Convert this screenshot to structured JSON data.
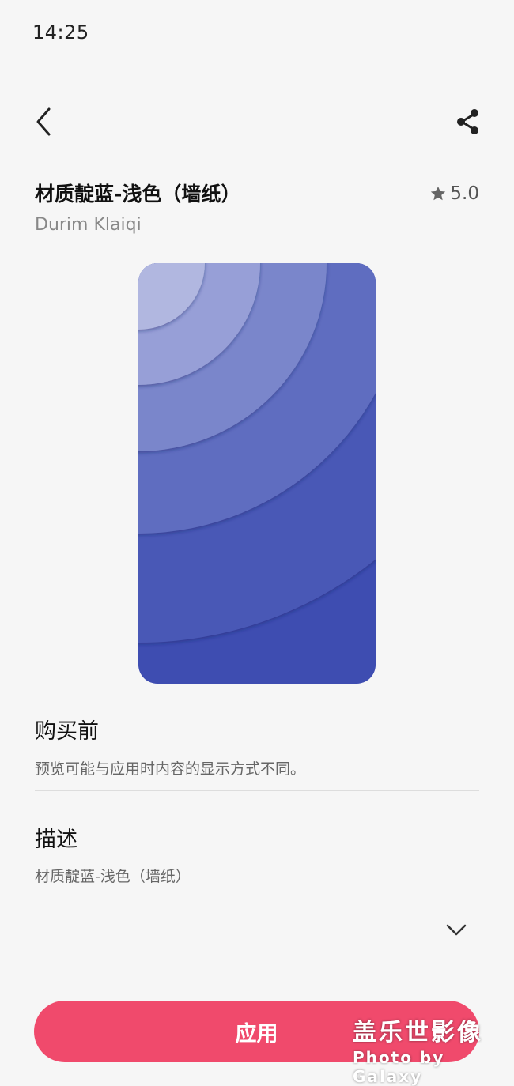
{
  "status_bar": {
    "time": "14:25"
  },
  "header": {
    "back_icon": "chevron-left-icon",
    "share_icon": "share-icon"
  },
  "item": {
    "title": "材质靛蓝-浅色（墙纸）",
    "author": "Durim Klaiqi",
    "rating": "5.0",
    "rating_icon": "star-icon"
  },
  "preview": {
    "colors": [
      "#b1b7e0",
      "#979fd7",
      "#7a86cb",
      "#5f6dc0",
      "#4a58b6",
      "#3e4db1"
    ]
  },
  "before_purchase": {
    "title": "购买前",
    "text": "预览可能与应用时内容的显示方式不同。"
  },
  "description": {
    "title": "描述",
    "text": "材质靛蓝-浅色（墙纸）",
    "expand_icon": "chevron-down-icon"
  },
  "apply_button": {
    "label": "应用",
    "color": "#f04a6c"
  },
  "watermark": {
    "main": "盖乐世影像",
    "sub": "Photo by Galaxy"
  }
}
